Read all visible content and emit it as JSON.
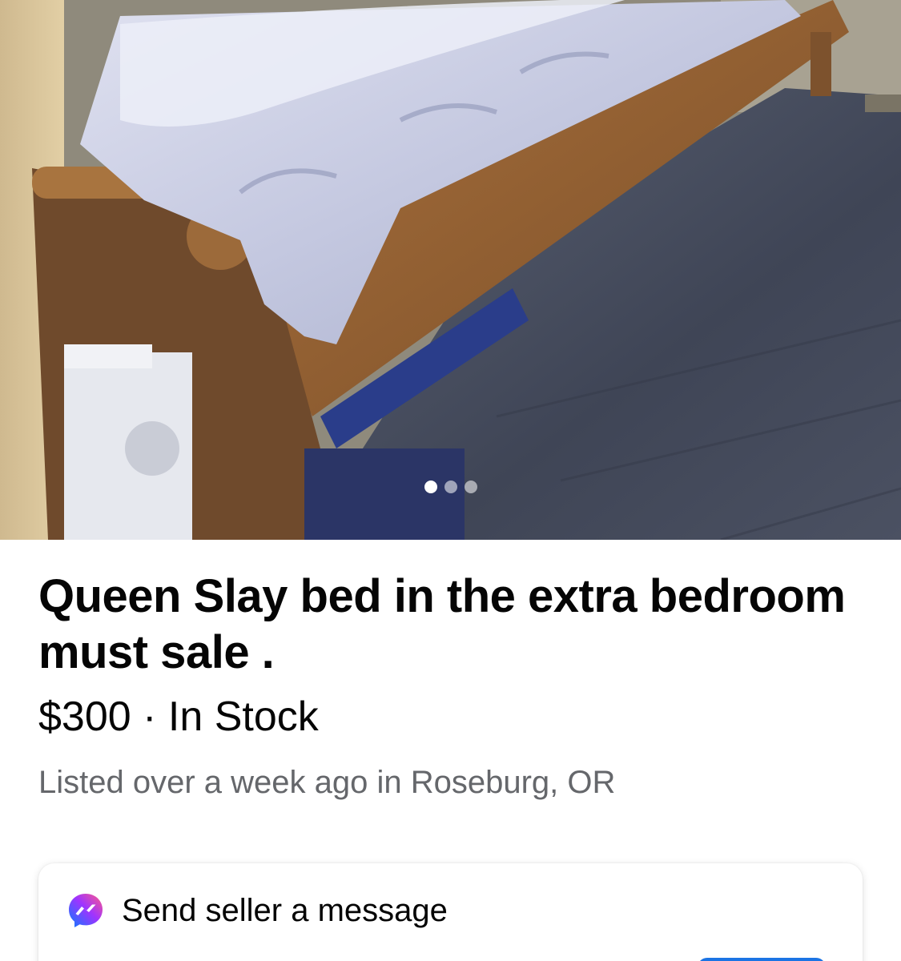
{
  "listing": {
    "title": "Queen Slay bed in the extra bedroom must sale .",
    "price": "$300",
    "separator": "·",
    "stock_status": "In Stock",
    "listed_text": "Listed over a week ago in Roseburg, OR"
  },
  "gallery": {
    "image_count": 3,
    "active_index": 0
  },
  "message_card": {
    "label": "Send seller a message",
    "icon": "messenger-icon"
  },
  "colors": {
    "text_primary": "#050505",
    "text_secondary": "#65676b",
    "accent": "#1b74e4"
  }
}
